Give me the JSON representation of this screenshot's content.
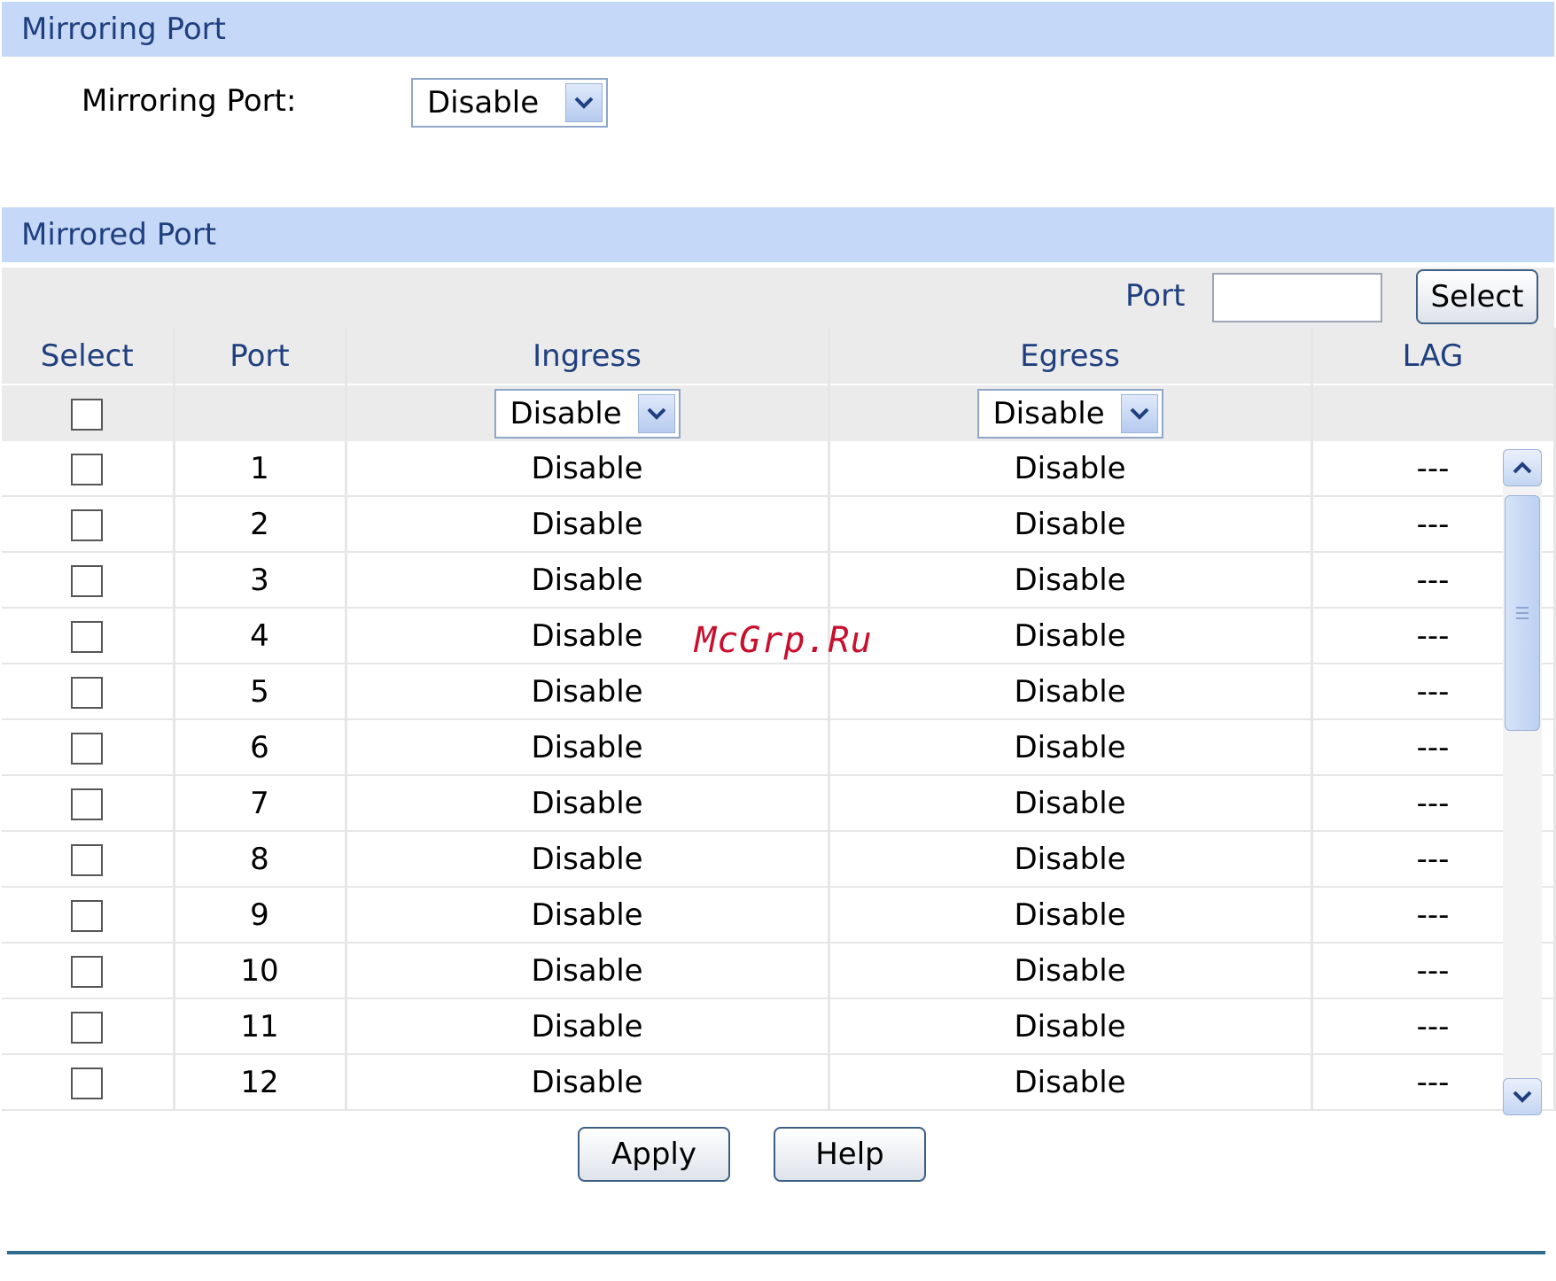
{
  "mirroring_section": {
    "title": "Mirroring Port",
    "field_label": "Mirroring Port:",
    "selected": "Disable"
  },
  "mirrored_section": {
    "title": "Mirrored Port",
    "filter": {
      "label": "Port",
      "value": "",
      "button": "Select"
    },
    "columns": {
      "select": "Select",
      "port": "Port",
      "ingress": "Ingress",
      "egress": "Egress",
      "lag": "LAG"
    },
    "bulk": {
      "ingress": "Disable",
      "egress": "Disable"
    },
    "rows": [
      {
        "port": "1",
        "ingress": "Disable",
        "egress": "Disable",
        "lag": "---"
      },
      {
        "port": "2",
        "ingress": "Disable",
        "egress": "Disable",
        "lag": "---"
      },
      {
        "port": "3",
        "ingress": "Disable",
        "egress": "Disable",
        "lag": "---"
      },
      {
        "port": "4",
        "ingress": "Disable",
        "egress": "Disable",
        "lag": "---"
      },
      {
        "port": "5",
        "ingress": "Disable",
        "egress": "Disable",
        "lag": "---"
      },
      {
        "port": "6",
        "ingress": "Disable",
        "egress": "Disable",
        "lag": "---"
      },
      {
        "port": "7",
        "ingress": "Disable",
        "egress": "Disable",
        "lag": "---"
      },
      {
        "port": "8",
        "ingress": "Disable",
        "egress": "Disable",
        "lag": "---"
      },
      {
        "port": "9",
        "ingress": "Disable",
        "egress": "Disable",
        "lag": "---"
      },
      {
        "port": "10",
        "ingress": "Disable",
        "egress": "Disable",
        "lag": "---"
      },
      {
        "port": "11",
        "ingress": "Disable",
        "egress": "Disable",
        "lag": "---"
      },
      {
        "port": "12",
        "ingress": "Disable",
        "egress": "Disable",
        "lag": "---"
      }
    ]
  },
  "actions": {
    "apply": "Apply",
    "help": "Help"
  },
  "watermark": "McGrp.Ru",
  "colors": {
    "header_bg": "#c6d8f8",
    "header_text": "#1f3f7f",
    "table_bg": "#ebebeb",
    "rule": "#2e6b8c"
  }
}
